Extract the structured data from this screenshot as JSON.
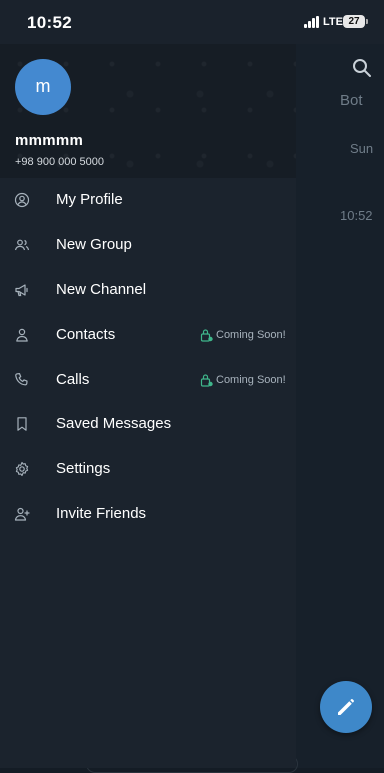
{
  "status_bar": {
    "time": "10:52",
    "network": "LTE",
    "battery": "27"
  },
  "background_screen": {
    "header_title": "Bot",
    "date_label": "Sun",
    "time_label": "10:52",
    "search_icon": "search-icon",
    "compose_icon": "pencil-icon"
  },
  "profile": {
    "avatar_letter": "m",
    "name": "mmmmm",
    "phone": "+98 900 000 5000"
  },
  "menu": {
    "items": [
      {
        "label": "My Profile",
        "icon": "profile-icon"
      },
      {
        "label": "New Group",
        "icon": "group-icon"
      },
      {
        "label": "New Channel",
        "icon": "megaphone-icon"
      },
      {
        "label": "Contacts",
        "icon": "contact-icon",
        "badge": "Coming Soon!"
      },
      {
        "label": "Calls",
        "icon": "phone-icon",
        "badge": "Coming Soon!"
      },
      {
        "label": "Saved Messages",
        "icon": "bookmark-icon"
      },
      {
        "label": "Settings",
        "icon": "gear-icon"
      },
      {
        "label": "Invite Friends",
        "icon": "add-user-icon"
      }
    ]
  },
  "colors": {
    "accent": "#4489d0",
    "drawer_bg": "#1b232d",
    "badge_lock": "#3fb68b"
  }
}
